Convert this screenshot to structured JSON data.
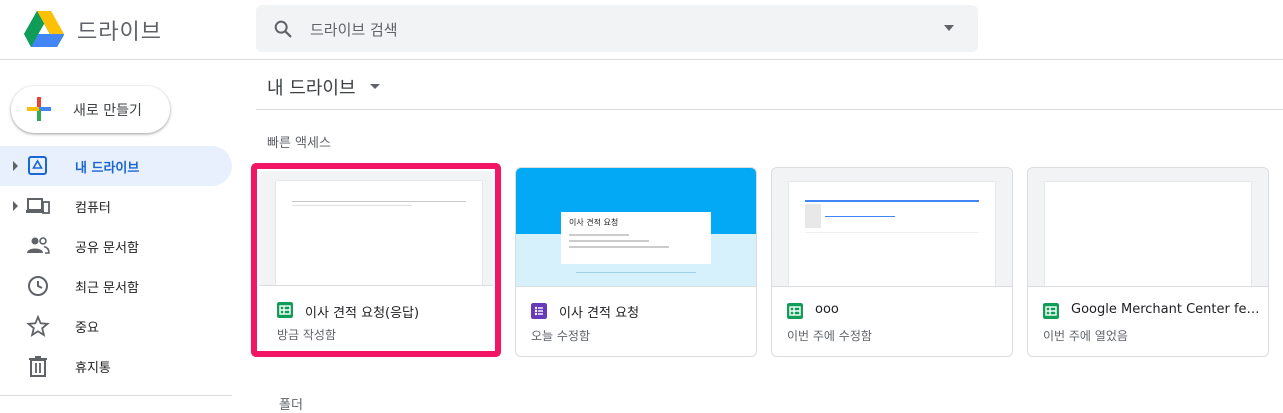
{
  "header": {
    "app_title": "드라이브",
    "search_placeholder": "드라이브 검색"
  },
  "sidebar": {
    "new_button": "새로 만들기",
    "items": [
      {
        "label": "내 드라이브",
        "icon": "my-drive-icon",
        "active": true
      },
      {
        "label": "컴퓨터",
        "icon": "computer-icon",
        "active": false
      },
      {
        "label": "공유 문서함",
        "icon": "people-icon",
        "active": false
      },
      {
        "label": "최근 문서함",
        "icon": "clock-icon",
        "active": false
      },
      {
        "label": "중요",
        "icon": "star-icon",
        "active": false
      },
      {
        "label": "휴지통",
        "icon": "trash-icon",
        "active": false
      }
    ]
  },
  "main": {
    "breadcrumb": "내 드라이브",
    "quick_access_title": "빠른 액세스",
    "folders_title": "폴더",
    "cards": [
      {
        "name": "이사 견적 요청(응답)",
        "subtitle": "방금 작성함",
        "type": "sheets",
        "highlighted": true
      },
      {
        "name": "이사 견적 요청",
        "subtitle": "오늘 수정함",
        "type": "forms",
        "highlighted": false,
        "preview_title": "이사 견적 요청"
      },
      {
        "name": "ooo",
        "subtitle": "이번 주에 수정함",
        "type": "sheets",
        "highlighted": false
      },
      {
        "name": "Google Merchant Center feed...",
        "subtitle": "이번 주에 열었음",
        "type": "sheets",
        "highlighted": false
      }
    ]
  },
  "colors": {
    "accent": "#1967d2",
    "active_bg": "#e8f0fe",
    "highlight": "#f21764",
    "sheets": "#0f9d58",
    "forms": "#673ab7",
    "forms_preview": "#03a9f4"
  }
}
